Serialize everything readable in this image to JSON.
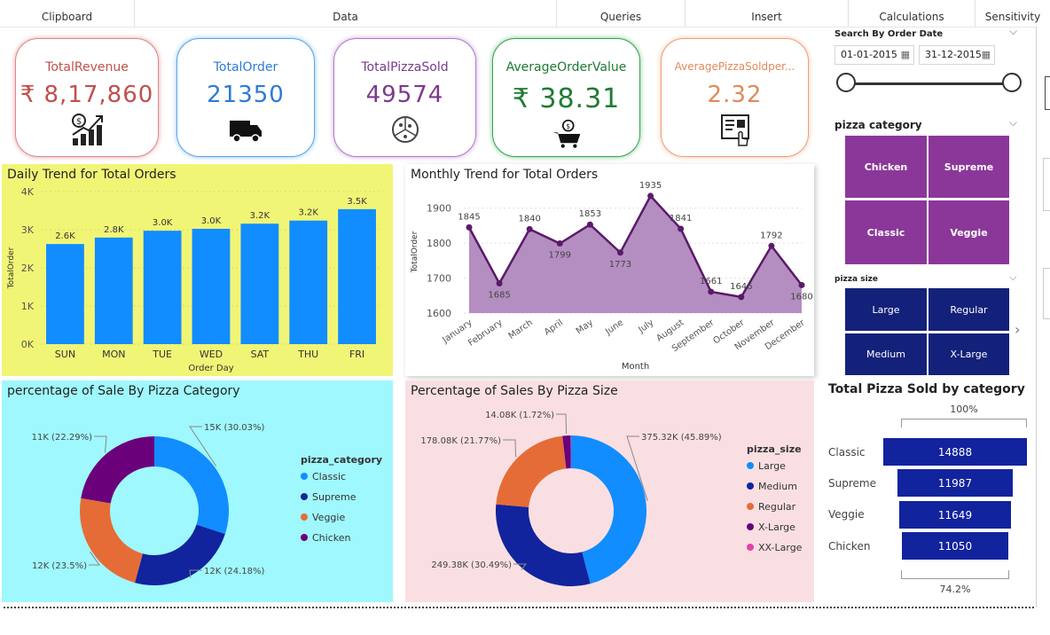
{
  "ribbon": [
    "Clipboard",
    "Data",
    "Queries",
    "Insert",
    "Calculations",
    "Sensitivity"
  ],
  "cards": [
    {
      "title": "TotalRevenue",
      "value": "₹ 8,17,860",
      "color": "#c0504d",
      "icon": "revenue-growth-icon"
    },
    {
      "title": "TotalOrder",
      "value": "21350",
      "color": "#2f7ad6",
      "icon": "delivery-truck-icon"
    },
    {
      "title": "TotalPizzaSold",
      "value": "49574",
      "color": "#7b3a8c",
      "icon": "pizza-icon"
    },
    {
      "title": "AverageOrderValue",
      "value": "₹ 38.31",
      "color": "#1e7b34",
      "icon": "shopping-cart-coin-icon"
    },
    {
      "title": "AveragePizzaSoldper...",
      "value": "2.32",
      "color": "#e08a5a",
      "icon": "order-tablet-icon"
    }
  ],
  "date_filter": {
    "label": "Search By Order Date",
    "start": "01-01-2015",
    "end": "31-12-2015"
  },
  "category_slicer": {
    "title": "pizza category",
    "items": [
      "Chicken",
      "Supreme",
      "Classic",
      "Veggie"
    ],
    "color": "#8b3799"
  },
  "size_slicer": {
    "title": "pizza size",
    "items": [
      "Large",
      "Regular",
      "Medium",
      "X-Large"
    ],
    "color": "#14217a"
  },
  "funnel": {
    "title": "Total Pizza Sold by category",
    "top_label": "100%",
    "bottom_label": "74.2%",
    "items": [
      {
        "name": "Classic",
        "value": 14888
      },
      {
        "name": "Supreme",
        "value": 11987
      },
      {
        "name": "Veggie",
        "value": 11649
      },
      {
        "name": "Chicken",
        "value": 11050
      }
    ]
  },
  "chart_data": [
    {
      "type": "bar",
      "title": "Daily Trend for Total Orders",
      "xlabel": "Order Day",
      "ylabel": "TotalOrder",
      "categories": [
        "SUN",
        "MON",
        "TUE",
        "WED",
        "SAT",
        "THU",
        "FRI"
      ],
      "values": [
        2624,
        2794,
        2973,
        3024,
        3158,
        3239,
        3538
      ],
      "data_labels": [
        "2.6K",
        "2.8K",
        "3.0K",
        "3.0K",
        "3.2K",
        "3.2K",
        "3.5K"
      ],
      "yticks": [
        "0K",
        "1K",
        "2K",
        "3K",
        "4K"
      ],
      "ylim": [
        0,
        4000
      ],
      "color": "#118dff",
      "background": "#f1f576"
    },
    {
      "type": "area",
      "title": "Monthly Trend for Total Orders",
      "xlabel": "Month",
      "ylabel": "TotalOrder",
      "categories": [
        "January",
        "February",
        "March",
        "April",
        "May",
        "June",
        "July",
        "August",
        "September",
        "October",
        "November",
        "December"
      ],
      "values": [
        1845,
        1685,
        1840,
        1799,
        1853,
        1773,
        1935,
        1841,
        1661,
        1646,
        1792,
        1680
      ],
      "data_labels": [
        "1845",
        "1685",
        "1840",
        "1799",
        "1853",
        "1773",
        "1935",
        "1841",
        "1661",
        "1646",
        "1792",
        "1680"
      ],
      "yticks": [
        "1600",
        "1700",
        "1800",
        "1900"
      ],
      "ylim": [
        1600,
        1950
      ],
      "color": "#5b1a68",
      "fill": "#b088be"
    },
    {
      "type": "pie",
      "title": "percentage of Sale By Pizza Category",
      "legend_title": "pizza_category",
      "series": [
        {
          "name": "Classic",
          "value": 15,
          "label": "15K (30.03%)",
          "color": "#118dff"
        },
        {
          "name": "Supreme",
          "value": 12.08,
          "label": "12K (24.18%)",
          "color": "#12239e"
        },
        {
          "name": "Veggie",
          "value": 11.74,
          "label": "12K (23.5%)",
          "color": "#e66c37"
        },
        {
          "name": "Chicken",
          "value": 11.14,
          "label": "11K (22.29%)",
          "color": "#6b007b"
        }
      ],
      "background": "#9ff8fd"
    },
    {
      "type": "pie",
      "title": "Percentage of Sales By Pizza Size",
      "legend_title": "pizza_size",
      "series": [
        {
          "name": "Large",
          "value": 375.32,
          "label": "375.32K (45.89%)",
          "color": "#118dff"
        },
        {
          "name": "Medium",
          "value": 249.38,
          "label": "249.38K (30.49%)",
          "color": "#12239e"
        },
        {
          "name": "Regular",
          "value": 178.08,
          "label": "178.08K (21.77%)",
          "color": "#e66c37"
        },
        {
          "name": "X-Large",
          "value": 14.08,
          "label": "14.08K (1.72%)",
          "color": "#6b007b"
        },
        {
          "name": "XX-Large",
          "value": 1.0,
          "label": "",
          "color": "#e044a7"
        }
      ],
      "background": "#fadfe2"
    }
  ]
}
